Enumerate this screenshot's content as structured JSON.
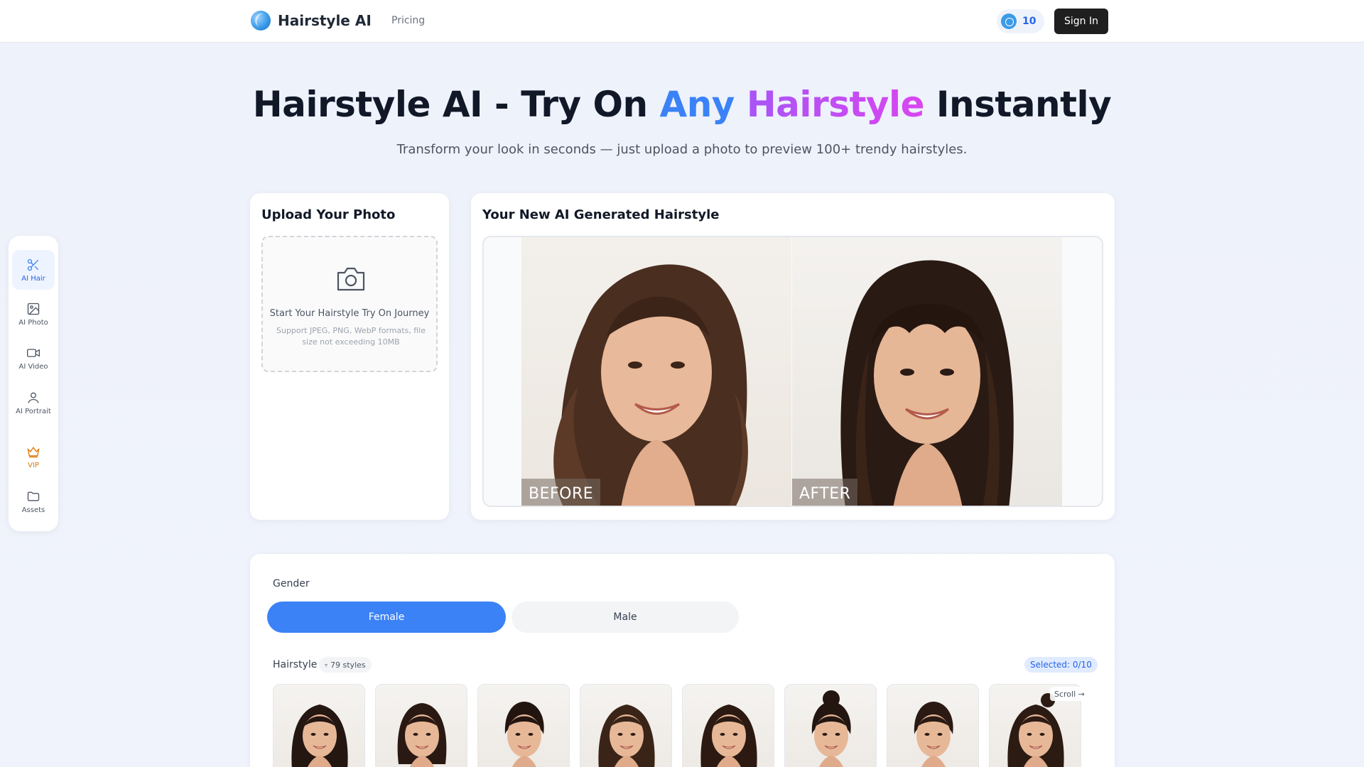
{
  "header": {
    "brand": "Hairstyle AI",
    "nav_pricing": "Pricing",
    "credits": "10",
    "sign_in": "Sign In"
  },
  "hero": {
    "title_part1": "Hairstyle AI - Try On ",
    "title_any": "Any",
    "title_hairstyle": "Hairstyle",
    "title_part2": " Instantly",
    "subtitle": "Transform your look in seconds — just upload a photo to preview 100+ trendy hairstyles."
  },
  "rail": {
    "items": [
      {
        "label": "AI Hair",
        "icon": "scissors-icon"
      },
      {
        "label": "AI Photo",
        "icon": "image-icon"
      },
      {
        "label": "AI Video",
        "icon": "video-icon"
      },
      {
        "label": "AI Portrait",
        "icon": "user-icon"
      },
      {
        "label": "VIP",
        "icon": "crown-icon"
      },
      {
        "label": "Assets",
        "icon": "folder-icon"
      }
    ]
  },
  "upload": {
    "title": "Upload Your Photo",
    "dropzone_title": "Start Your Hairstyle Try On Journey",
    "dropzone_sub": "Support JPEG, PNG, WebP formats, file size not exceeding 10MB"
  },
  "result": {
    "title": "Your New AI Generated Hairstyle",
    "before_label": "BEFORE",
    "after_label": "AFTER"
  },
  "options": {
    "gender_label": "Gender",
    "female": "Female",
    "male": "Male",
    "hairstyle_label": "Hairstyle",
    "styles_count": "79 styles",
    "selected": "Selected: 0/10",
    "scroll_hint": "Scroll →"
  },
  "colors": {
    "accent": "#3b82f6",
    "vip": "#d97706",
    "dark_button": "#1f1f1f"
  }
}
